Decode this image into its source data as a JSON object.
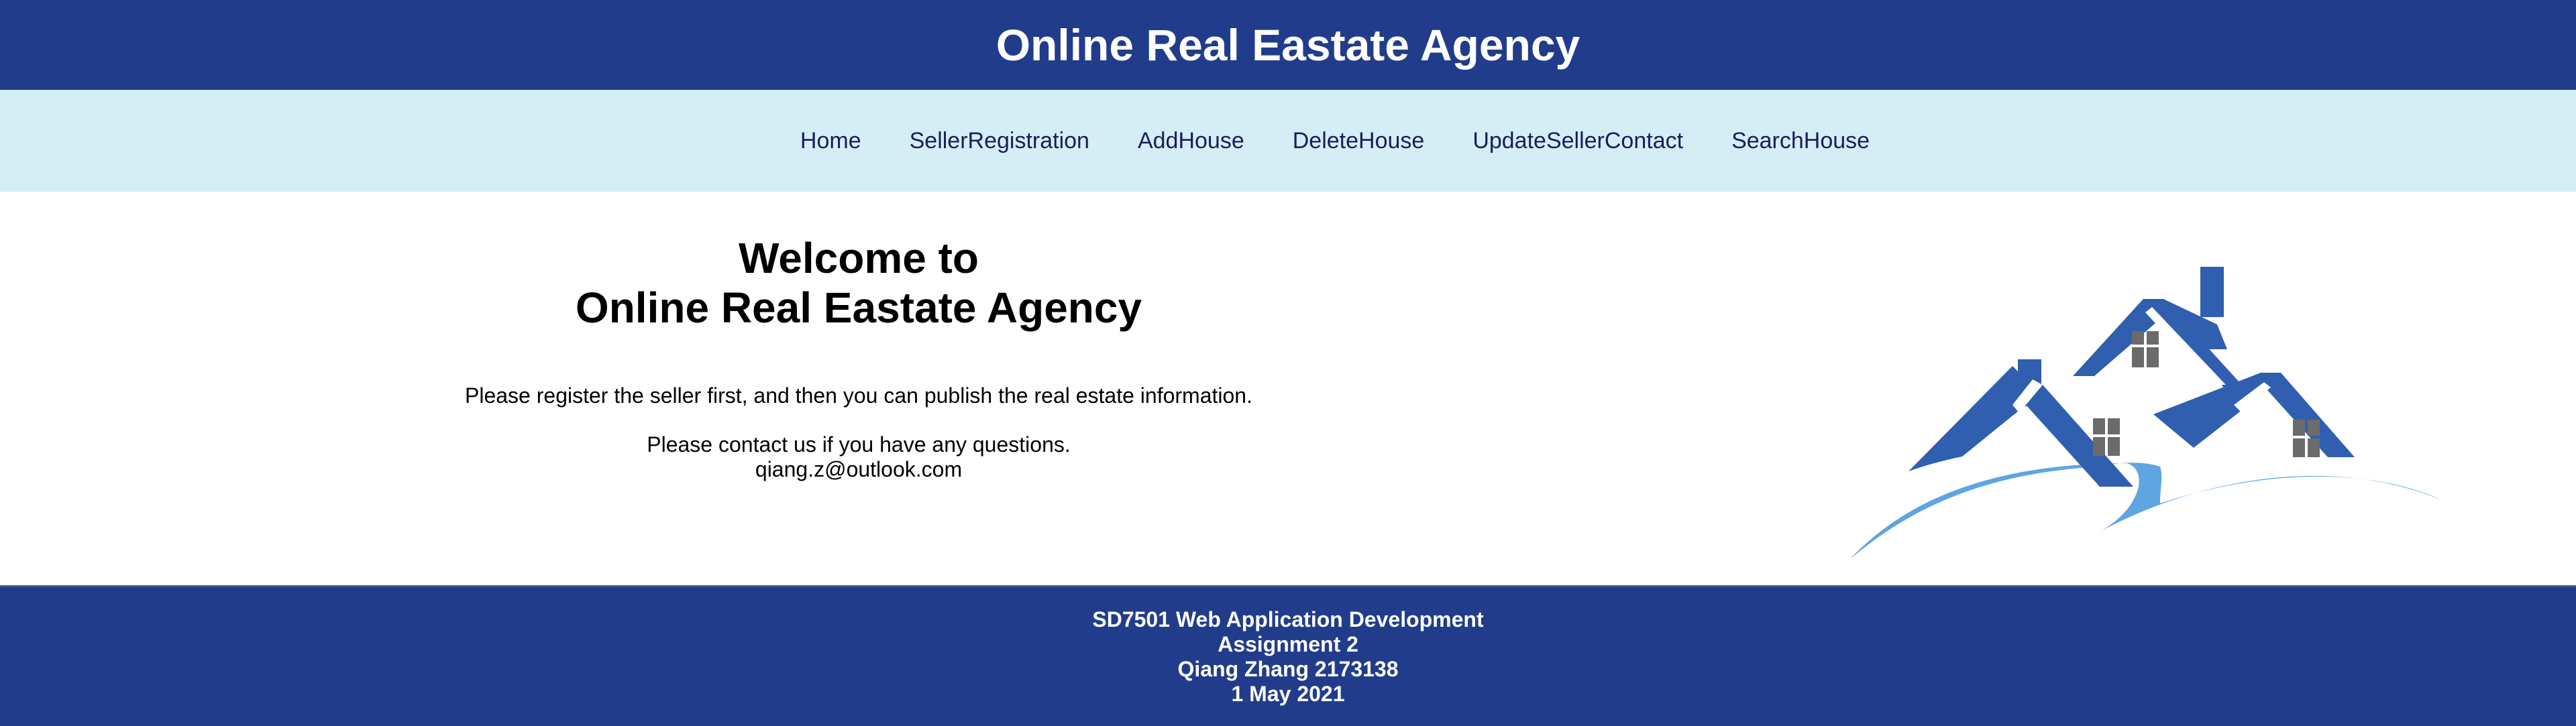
{
  "header": {
    "title": "Online Real Eastate Agency"
  },
  "nav": {
    "items": [
      {
        "label": "Home"
      },
      {
        "label": "SellerRegistration"
      },
      {
        "label": "AddHouse"
      },
      {
        "label": "DeleteHouse"
      },
      {
        "label": "UpdateSellerContact"
      },
      {
        "label": "SearchHouse"
      }
    ]
  },
  "main": {
    "welcome_line1": "Welcome to",
    "welcome_line2": "Online Real Eastate Agency",
    "intro": "Please register the seller first, and then you can publish the real estate information.",
    "contact": "Please contact us if you have any questions.",
    "email": "qiang.z@outlook.com",
    "logo_icon": "house-roofs-logo-icon"
  },
  "footer": {
    "line1": "SD7501 Web Application Development",
    "line2": "Assignment 2",
    "line3": "Qiang Zhang 2173138",
    "line4": "1 May 2021"
  },
  "colors": {
    "header_bg": "#213c8a",
    "nav_bg": "#d5eef6",
    "nav_text": "#1b1c5a",
    "roof_blue": "#2f5fae",
    "wave_blue": "#5ea5e2",
    "window_gray": "#6b6b6b"
  }
}
